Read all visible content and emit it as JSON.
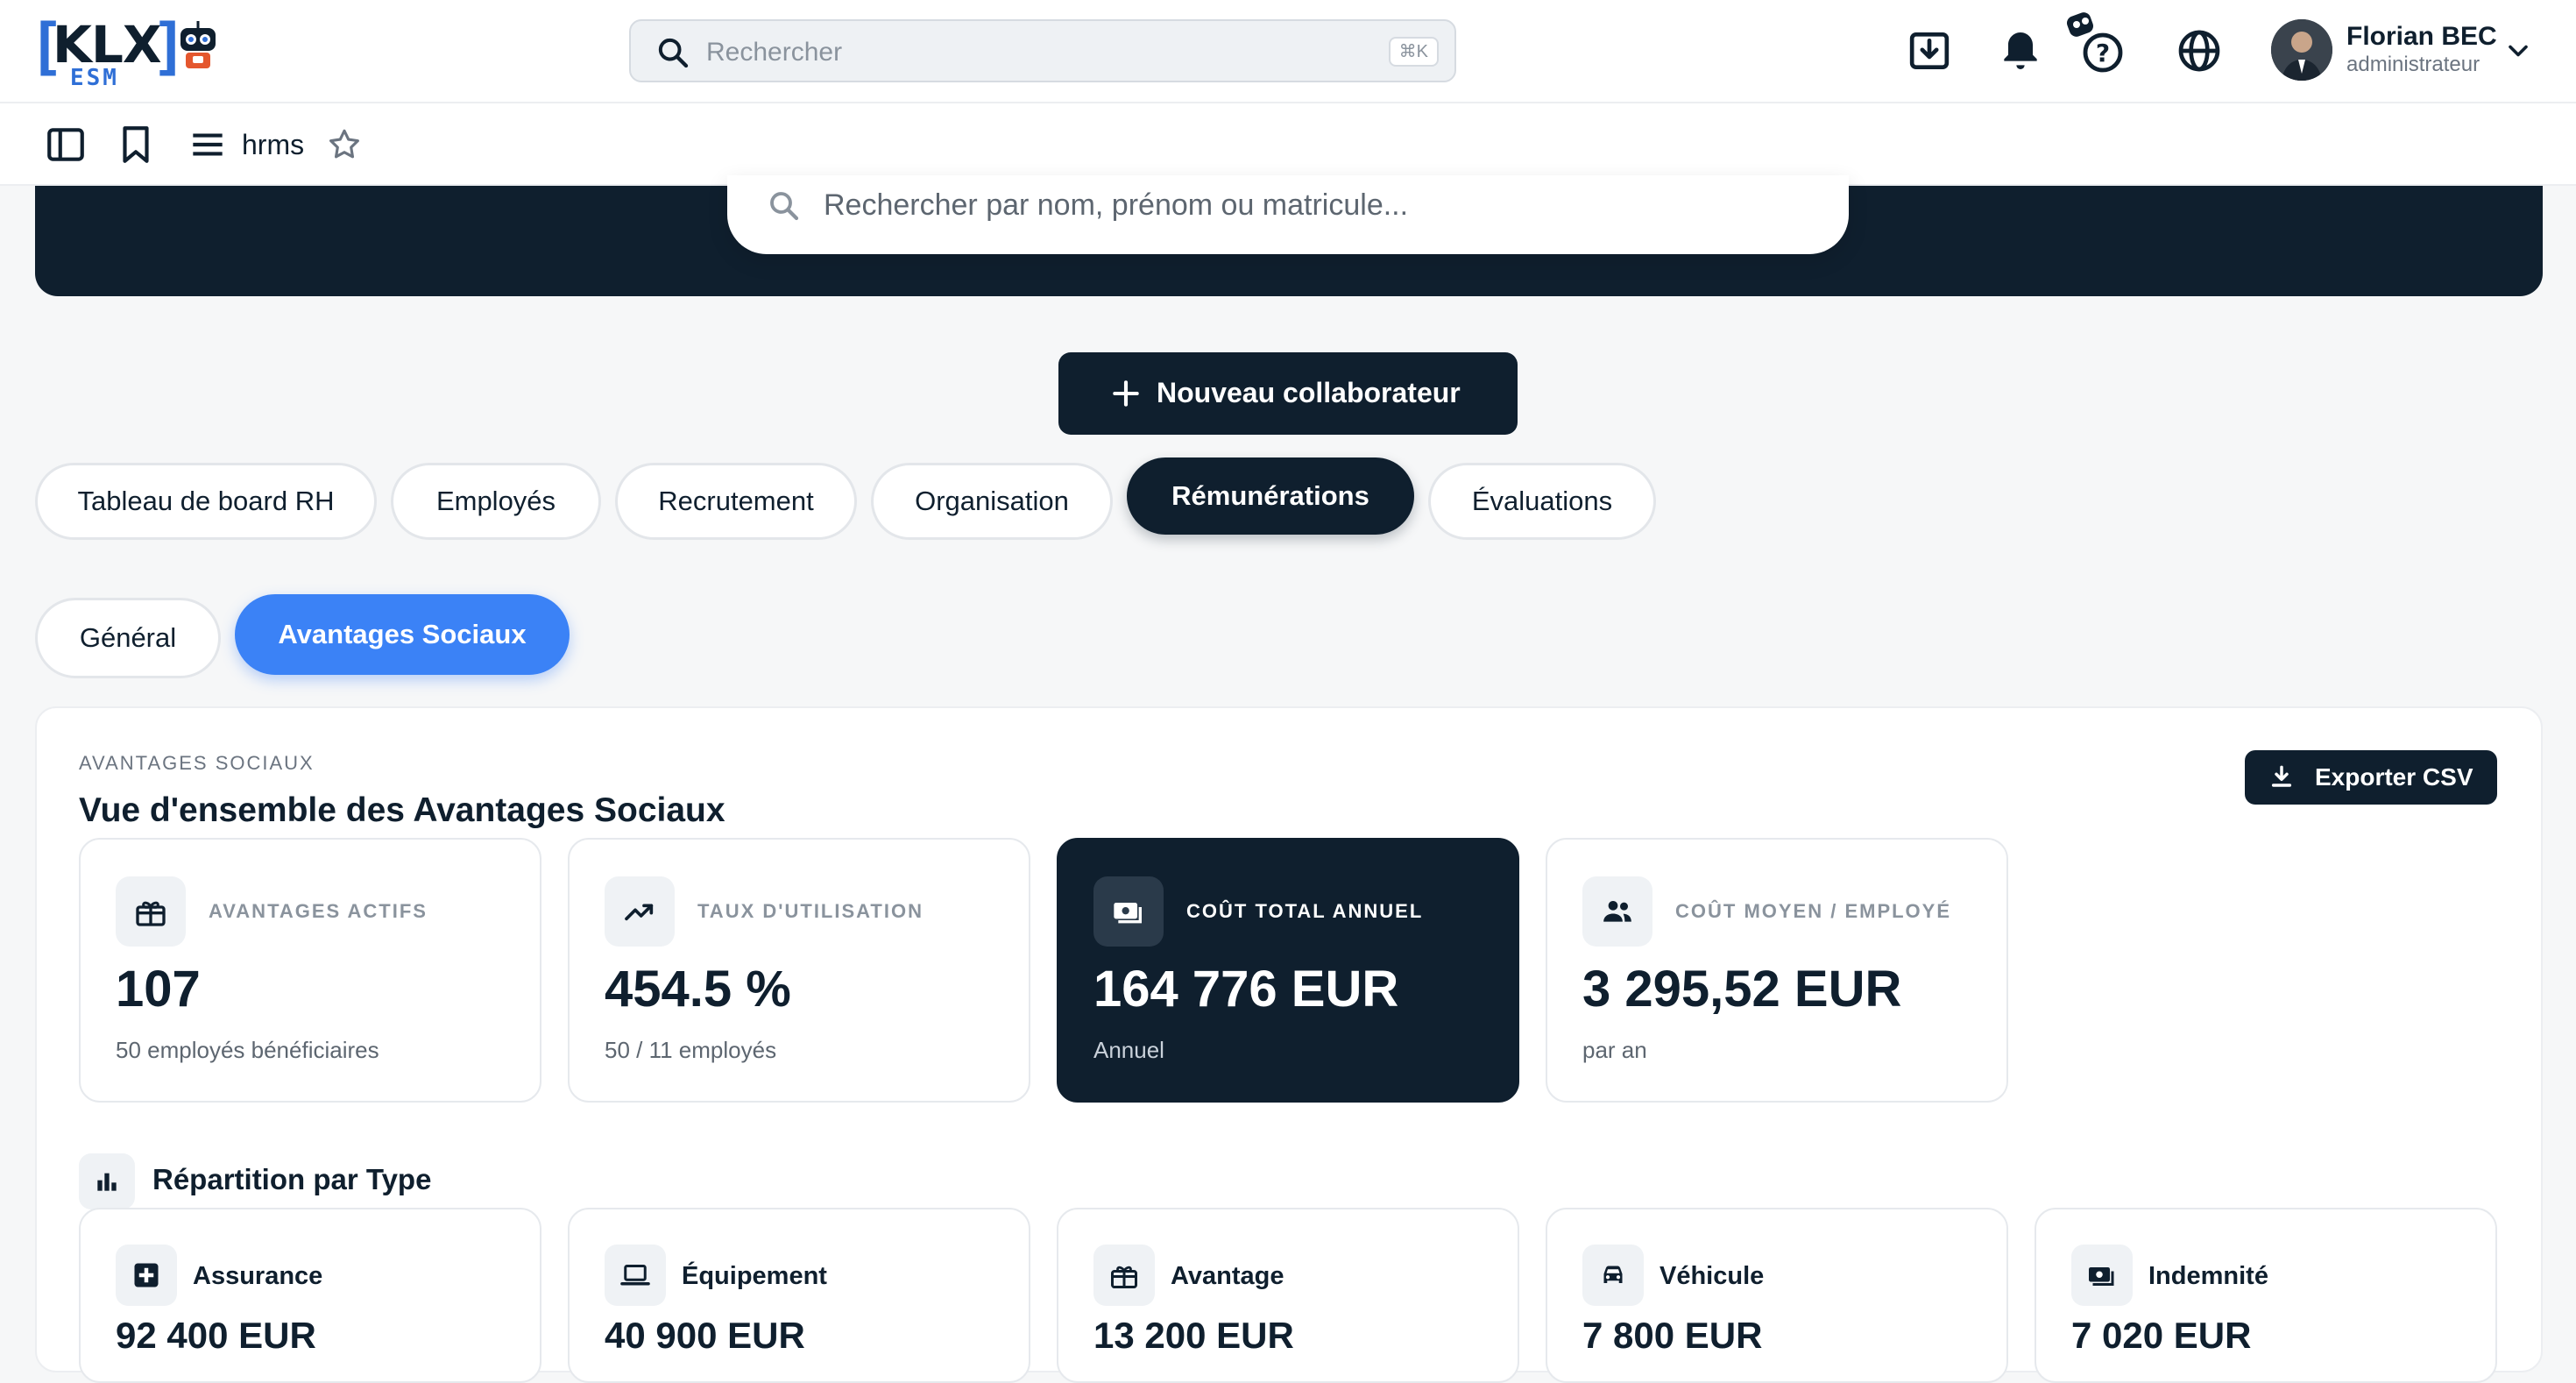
{
  "header": {
    "logo": {
      "brand": "KLX",
      "product": "ESM"
    },
    "search": {
      "placeholder": "Rechercher",
      "shortcut": "⌘K"
    },
    "user": {
      "name": "Florian BEC",
      "role": "administrateur"
    },
    "icons": [
      "download-tray-icon",
      "bell-icon",
      "robot-help-icon",
      "globe-icon",
      "chevron-down-icon"
    ]
  },
  "toolbar": {
    "module_label": "hrms"
  },
  "hero": {
    "search_placeholder": "Rechercher par nom, prénom ou matricule..."
  },
  "actions": {
    "new_collaborator": "Nouveau collaborateur"
  },
  "tabs": [
    {
      "label": "Tableau de board RH",
      "active": false
    },
    {
      "label": "Employés",
      "active": false
    },
    {
      "label": "Recrutement",
      "active": false
    },
    {
      "label": "Organisation",
      "active": false
    },
    {
      "label": "Rémunérations",
      "active": true
    },
    {
      "label": "Évaluations",
      "active": false
    }
  ],
  "subtabs": [
    {
      "label": "Général",
      "active": false
    },
    {
      "label": "Avantages Sociaux",
      "active": true
    }
  ],
  "panel": {
    "eyebrow": "AVANTAGES SOCIAUX",
    "title": "Vue d'ensemble des Avantages Sociaux",
    "export_label": "Exporter CSV",
    "stats": [
      {
        "label": "AVANTAGES ACTIFS",
        "value": "107",
        "sub": "50 employés bénéficiaires",
        "icon": "gift-icon"
      },
      {
        "label": "TAUX D'UTILISATION",
        "value": "454.5 %",
        "sub": "50 / 11 employés",
        "icon": "trending-up-icon"
      },
      {
        "label": "COÛT TOTAL ANNUEL",
        "value": "164 776 EUR",
        "sub": "Annuel",
        "icon": "money-icon"
      },
      {
        "label": "COÛT MOYEN / EMPLOYÉ",
        "value": "3 295,52 EUR",
        "sub": "par an",
        "icon": "people-icon"
      }
    ],
    "breakdown_title": "Répartition par Type",
    "types": [
      {
        "name": "Assurance",
        "value": "92 400 EUR",
        "icon": "medical-plus-icon"
      },
      {
        "name": "Équipement",
        "value": "40 900 EUR",
        "icon": "laptop-icon"
      },
      {
        "name": "Avantage",
        "value": "13 200 EUR",
        "icon": "gift-icon"
      },
      {
        "name": "Véhicule",
        "value": "7 800 EUR",
        "icon": "car-icon"
      },
      {
        "name": "Indemnité",
        "value": "7 020 EUR",
        "icon": "money-icon"
      }
    ]
  },
  "colors": {
    "navy": "#0f1f2e",
    "accent_blue": "#3b82f6",
    "logo_blue": "#2f6fd6",
    "background": "#f6f7f8"
  }
}
